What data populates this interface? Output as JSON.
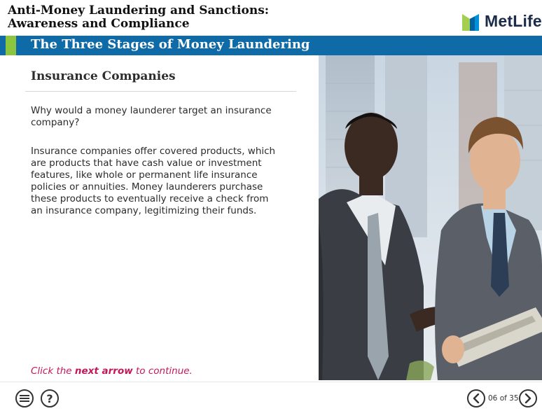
{
  "header": {
    "course_title_line1": "Anti-Money Laundering and Sanctions:",
    "course_title_line2": "Awareness and Compliance",
    "logo_text": "MetLife",
    "logo_colors": {
      "blue": "#0090da",
      "green": "#a4ce4e"
    }
  },
  "banner": {
    "title": "The Three Stages of Money Laundering",
    "color": "#0f6aa8",
    "accent_color": "#8cc63f"
  },
  "content": {
    "heading": "Insurance Companies",
    "question": "Why would a money launderer target an insurance company?",
    "answer": "Insurance companies offer covered products, which are products that have cash value or investment features, like whole or permanent life insurance policies or annuities. Money launderers purchase these products to eventually receive a check from an insurance company, legitimizing their funds.",
    "cta_prefix": "Click the ",
    "cta_bold": "next arrow",
    "cta_suffix": " to continue.",
    "cta_color": "#c2185b"
  },
  "image": {
    "icon": "photo-two-businessmen-with-tablet"
  },
  "footer": {
    "menu_icon": "hamburger-icon",
    "help_label": "?",
    "prev_icon": "chevron-left-icon",
    "next_icon": "chevron-right-icon",
    "page_counter": "06 of 35"
  }
}
